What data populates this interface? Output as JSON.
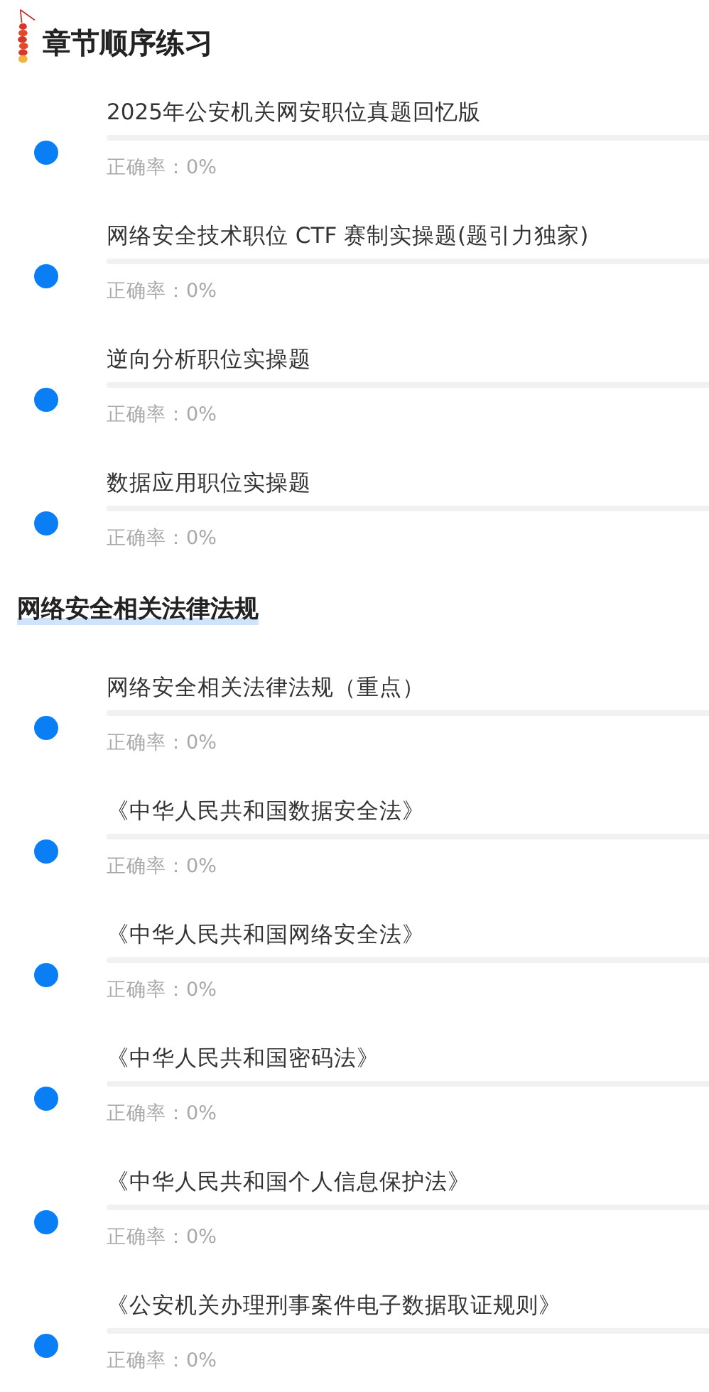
{
  "sections": [
    {
      "kind": "icon",
      "title": "章节顺序练习",
      "items": [
        {
          "title": "2025年公安机关网安职位真题回忆版",
          "level": 0,
          "accuracy": "正确率：0%"
        },
        {
          "title": "网络安全技术职位 CTF 赛制实操题(题引力独家)",
          "level": 0,
          "accuracy": "正确率：0%"
        },
        {
          "title": "逆向分析职位实操题",
          "level": 0,
          "accuracy": "正确率：0%"
        },
        {
          "title": "数据应用职位实操题",
          "level": 0,
          "accuracy": "正确率：0%"
        }
      ]
    },
    {
      "kind": "underline",
      "title": "网络安全相关法律法规",
      "items": [
        {
          "title": "网络安全相关法律法规（重点）",
          "level": 0,
          "accuracy": "正确率：0%"
        },
        {
          "title": "《中华人民共和国数据安全法》",
          "level": 0,
          "accuracy": "正确率：0%"
        },
        {
          "title": "《中华人民共和国网络安全法》",
          "level": 0,
          "accuracy": "正确率：0%"
        },
        {
          "title": "《中华人民共和国密码法》",
          "level": 0,
          "accuracy": "正确率：0%"
        },
        {
          "title": "《中华人民共和国个人信息保护法》",
          "level": 0,
          "accuracy": "正确率：0%"
        },
        {
          "title": "《公安机关办理刑事案件电子数据取证规则》",
          "level": 0,
          "accuracy": "正确率：0%"
        }
      ]
    }
  ]
}
